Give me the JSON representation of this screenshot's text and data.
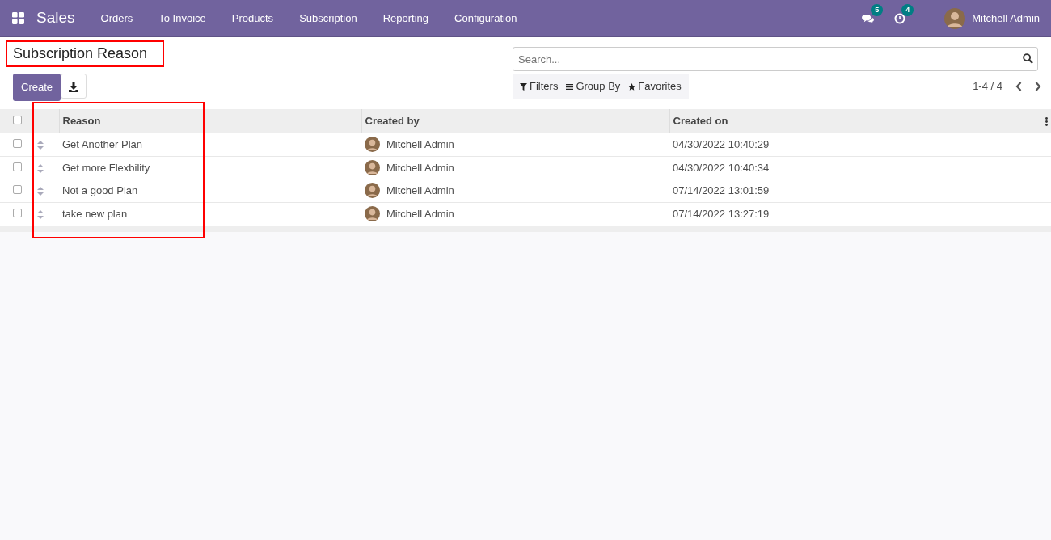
{
  "navbar": {
    "app_name": "Sales",
    "menu": [
      "Orders",
      "To Invoice",
      "Products",
      "Subscription",
      "Reporting",
      "Configuration"
    ],
    "messages_count": "5",
    "activities_count": "4",
    "user_name": "Mitchell Admin"
  },
  "control_panel": {
    "title": "Subscription Reason",
    "create_label": "Create",
    "search": {
      "placeholder": "Search..."
    },
    "filters": [
      "Filters",
      "Group By",
      "Favorites"
    ],
    "pager": "1-4 / 4"
  },
  "table": {
    "select_all": {
      "checked": false
    },
    "columns": [
      "Reason",
      "Created by",
      "Created on"
    ],
    "rows": [
      {
        "selected": false,
        "reason": "Get Another Plan",
        "created_by": "Mitchell Admin",
        "created_on": "04/30/2022 10:40:29"
      },
      {
        "selected": false,
        "reason": "Get more Flexbility",
        "created_by": "Mitchell Admin",
        "created_on": "04/30/2022 10:40:34"
      },
      {
        "selected": false,
        "reason": "Not a good Plan",
        "created_by": "Mitchell Admin",
        "created_on": "07/14/2022 13:01:59"
      },
      {
        "selected": false,
        "reason": "take new plan",
        "created_by": "Mitchell Admin",
        "created_on": "07/14/2022 13:27:19"
      }
    ]
  }
}
